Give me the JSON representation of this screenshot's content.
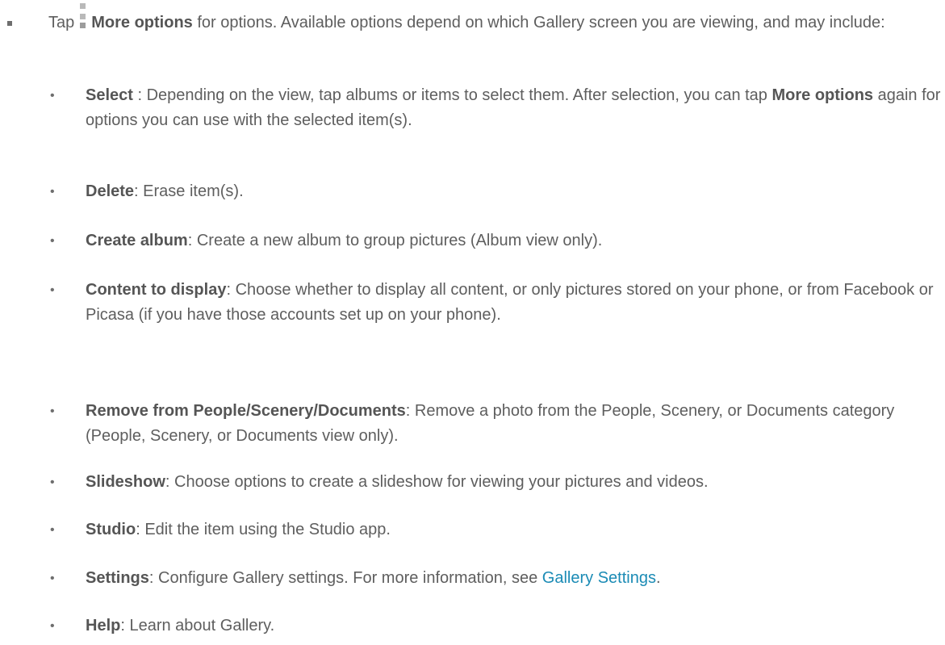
{
  "intro": {
    "tap": "Tap",
    "icon": "more-options-icon",
    "more_options": "More options",
    "rest": " for options. Available options depend on which Gallery screen you are viewing, and may include:"
  },
  "options": [
    {
      "term": "Select",
      "sep": " : ",
      "desc1": "Depending on the view, tap albums or items to select them. After selection, you can tap ",
      "desc_bold": "More options",
      "desc2": " again for options you can use with the selected item(s)."
    },
    {
      "term": "Delete",
      "sep": ": ",
      "desc": "Erase item(s)."
    },
    {
      "term": "Create album",
      "sep": ": ",
      "desc": "Create a new album to group pictures (Album view only)."
    },
    {
      "term": "Content to display",
      "sep": ": ",
      "desc": "Choose whether to display all content, or only pictures stored on your phone, or from Facebook or Picasa (if you have those accounts set up on your phone)."
    },
    {
      "term": "Remove from People/Scenery/Documents",
      "sep": ": ",
      "desc": "Remove a photo from the People, Scenery, or Documents category (People, Scenery, or Documents view only)."
    },
    {
      "term": "Slideshow",
      "sep": ": ",
      "desc": "Choose options to create a slideshow for viewing your pictures and videos."
    },
    {
      "term": "Studio",
      "sep": ": ",
      "desc": "Edit the item using the Studio app."
    },
    {
      "term": "Settings",
      "sep": ": ",
      "desc": "Configure Gallery settings. For more information, see ",
      "link": "Gallery Settings",
      "after": "."
    },
    {
      "term": "Help",
      "sep": ": ",
      "desc": "Learn about Gallery."
    }
  ],
  "bullet_char": "•",
  "colors": {
    "text": "#5e5e5e",
    "link": "#1b8bb5"
  }
}
